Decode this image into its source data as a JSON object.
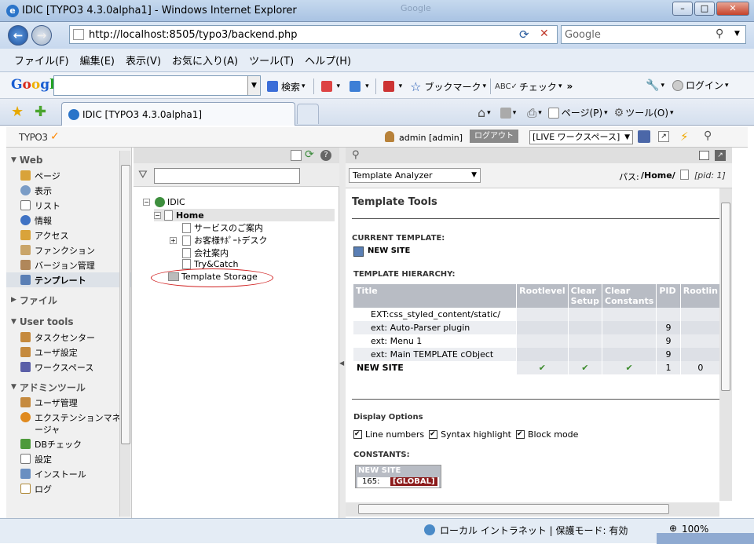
{
  "window": {
    "title": "IDIC [TYPO3 4.3.0alpha1] - Windows Internet Explorer",
    "bg_search": "Google",
    "min": "–",
    "max": "□",
    "close": "✕"
  },
  "address": {
    "url": "http://localhost:8505/typo3/backend.php",
    "search_placeholder": "Google"
  },
  "menu": [
    "ファイル(F)",
    "編集(E)",
    "表示(V)",
    "お気に入り(A)",
    "ツール(T)",
    "ヘルプ(H)"
  ],
  "gbar": {
    "logo": "Google",
    "search": "検索",
    "bookmarks": "ブックマーク",
    "check": "チェック",
    "more": "»",
    "login": "ログイン"
  },
  "tab": {
    "title": "IDIC [TYPO3 4.3.0alpha1]",
    "page": "ページ(P)",
    "tools": "ツール(O)"
  },
  "t3": {
    "logo": "TYPO3",
    "user": "admin [admin]",
    "logout": "ログアウト",
    "workspace": "[LIVE ワークスペース]"
  },
  "modules": [
    {
      "title": "Web",
      "items": [
        "ページ",
        "表示",
        "リスト",
        "情報",
        "アクセス",
        "ファンクション",
        "バージョン管理",
        "テンプレート"
      ]
    },
    {
      "title": "ファイル",
      "items": []
    },
    {
      "title": "User tools",
      "items": [
        "タスクセンター",
        "ユーザ設定",
        "ワークスペース"
      ]
    },
    {
      "title": "アドミンツール",
      "items": [
        "ユーザ管理",
        "エクステンションマネージャ",
        "DBチェック",
        "設定",
        "インストール",
        "ログ"
      ]
    }
  ],
  "tree": {
    "root": "IDIC",
    "home": "Home",
    "children": [
      "サービスのご案内",
      "お客様ｻﾎﾟｰﾄデスク",
      "会社案内",
      "Try&Catch"
    ],
    "storage": "Template Storage"
  },
  "content": {
    "select": "Template Analyzer",
    "path_label": "パス:",
    "path": "/Home/",
    "pid": "[pid: 1]",
    "heading": "Template Tools",
    "current_label": "CURRENT TEMPLATE:",
    "current": "NEW SITE",
    "hier_label": "TEMPLATE HIERARCHY:",
    "columns": [
      "Title",
      "Rootlevel",
      "Clear Setup",
      "Clear Constants",
      "PID",
      "Rootlin"
    ],
    "rows": [
      {
        "title": "EXT:css_styled_content/static/",
        "root": "",
        "setup": "",
        "const": "",
        "pid": "",
        "rl": ""
      },
      {
        "title": "ext: Auto-Parser plugin",
        "root": "",
        "setup": "",
        "const": "",
        "pid": "9",
        "rl": ""
      },
      {
        "title": "ext: Menu 1",
        "root": "",
        "setup": "",
        "const": "",
        "pid": "9",
        "rl": ""
      },
      {
        "title": "ext: Main TEMPLATE cObject",
        "root": "",
        "setup": "",
        "const": "",
        "pid": "9",
        "rl": ""
      },
      {
        "title": "NEW SITE",
        "root": "✔",
        "setup": "✔",
        "const": "✔",
        "pid": "1",
        "rl": "0"
      }
    ],
    "display_label": "Display Options",
    "options": [
      "Line numbers",
      "Syntax highlight",
      "Block mode"
    ],
    "constants_label": "CONSTANTS:",
    "const_site": "NEW SITE",
    "const_line": "165:",
    "const_global": "[GLOBAL]"
  },
  "status": {
    "zone": "ローカル イントラネット | 保護モード: 有効",
    "zoom": "100%"
  }
}
